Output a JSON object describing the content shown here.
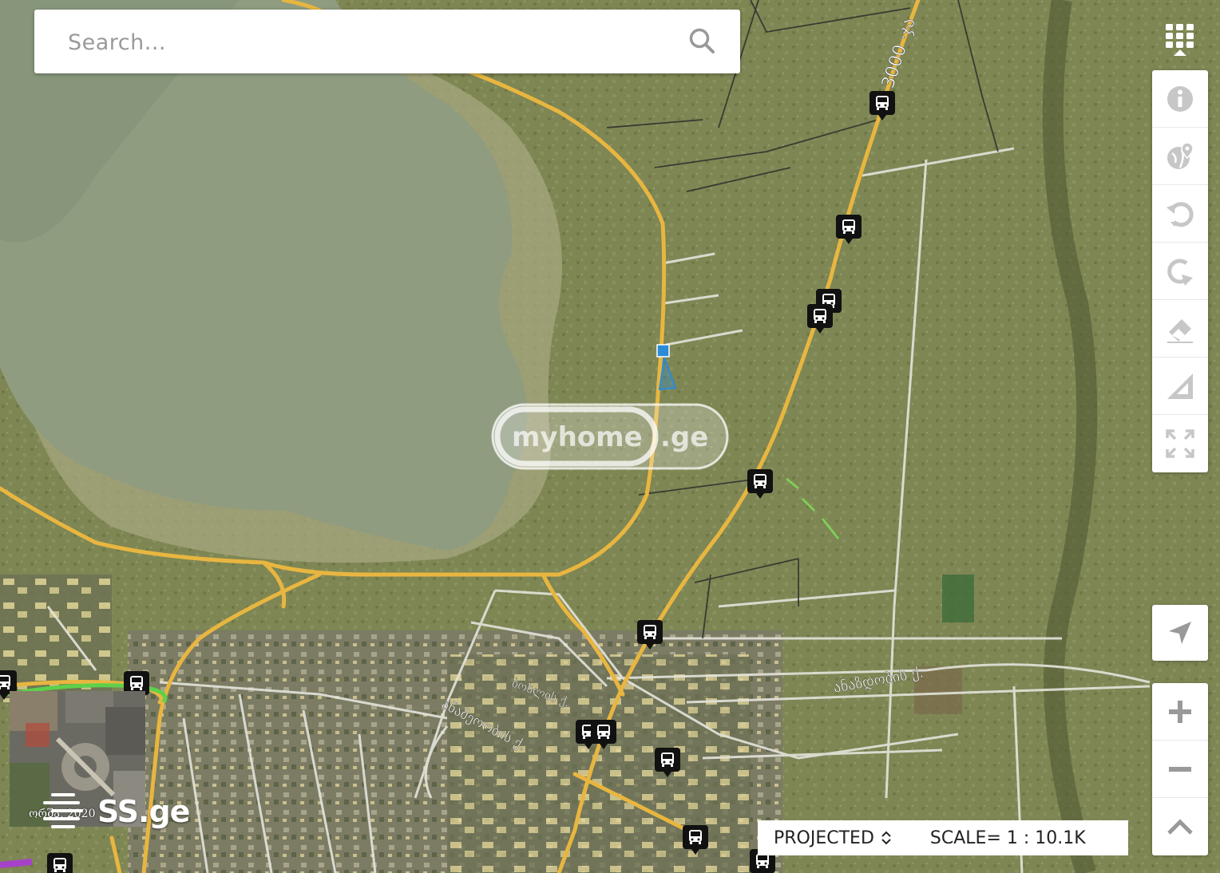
{
  "search": {
    "placeholder": "Search..."
  },
  "toolbar": {
    "apps_icon": "grid-apps-icon",
    "tools": [
      {
        "name": "info",
        "icon": "info-icon"
      },
      {
        "name": "globe-location",
        "icon": "globe-pin-icon"
      },
      {
        "name": "rotate-left",
        "icon": "rotate-ccw-icon"
      },
      {
        "name": "rotate-right",
        "icon": "rotate-cw-icon"
      },
      {
        "name": "eraser",
        "icon": "eraser-icon"
      },
      {
        "name": "measure",
        "icon": "ruler-triangle-icon"
      },
      {
        "name": "fullscreen",
        "icon": "fullscreen-icon"
      }
    ]
  },
  "navigation": {
    "locate_icon": "navigation-arrow-icon",
    "zoom_in_icon": "plus-icon",
    "zoom_out_icon": "minus-icon",
    "collapse_icon": "chevron-up-icon"
  },
  "scale": {
    "projection_label": "PROJECTED",
    "scale_label": "SCALE= 1 : 10.1K"
  },
  "minimap": {
    "date_label": "ორშა, 2020"
  },
  "branding": {
    "ssge": "SS.ge",
    "watermark_left": "myhome",
    "watermark_right": ".ge"
  },
  "map_labels": {
    "road_top": "3000 ·ჯა",
    "street_1": "ანაზდობის ქ.",
    "street_2": "ანამეოობის ქ.",
    "street_3": "ბოსლის ქ."
  },
  "colors": {
    "road": "#e8b640",
    "minor_road": "#e4e4dc",
    "lake": "#8f9c80",
    "parcel": "#2b8bd8",
    "marker_bg": "#111111"
  }
}
